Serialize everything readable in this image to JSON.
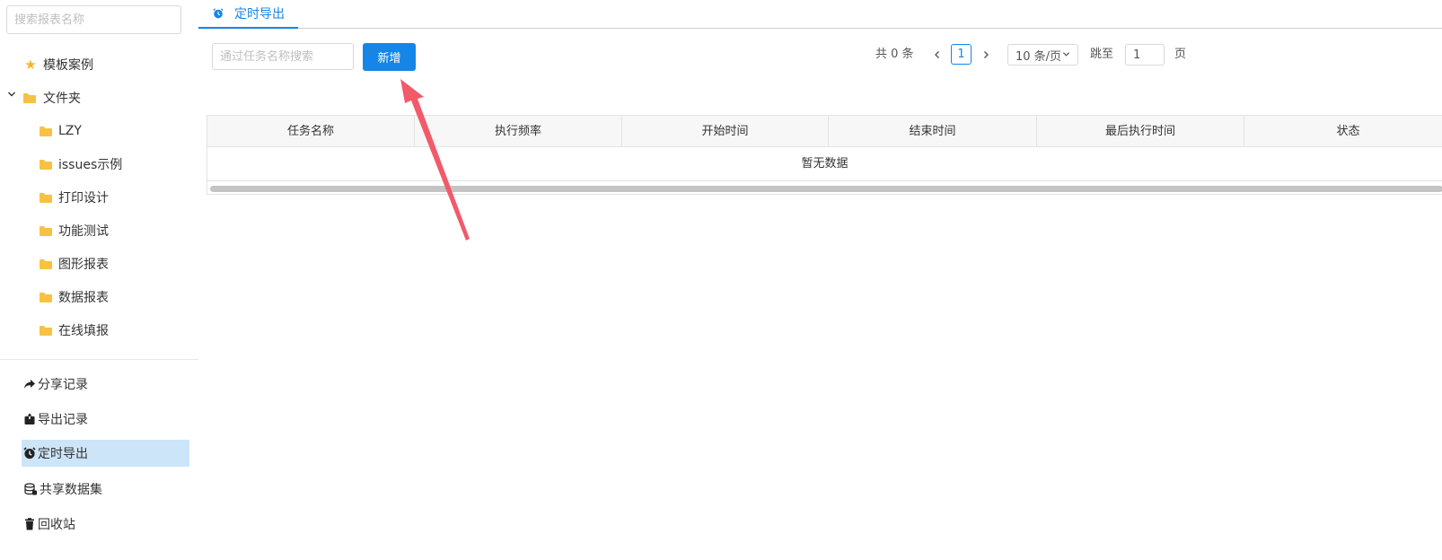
{
  "sidebar": {
    "search_placeholder": "搜索报表名称",
    "tree": [
      {
        "label": "模板案例",
        "icon": "star-icon"
      },
      {
        "label": "文件夹",
        "icon": "folder-icon"
      },
      {
        "label": "LZY",
        "icon": "folder-icon"
      },
      {
        "label": "issues示例",
        "icon": "folder-icon"
      },
      {
        "label": "打印设计",
        "icon": "folder-icon"
      },
      {
        "label": "功能测试",
        "icon": "folder-icon"
      },
      {
        "label": "图形报表",
        "icon": "folder-icon"
      },
      {
        "label": "数据报表",
        "icon": "folder-icon"
      },
      {
        "label": "在线填报",
        "icon": "folder-icon"
      }
    ],
    "bottom": [
      {
        "label": "分享记录",
        "icon": "share-icon"
      },
      {
        "label": "导出记录",
        "icon": "export-icon"
      },
      {
        "label": "定时导出",
        "icon": "alarm-clock-icon",
        "active": true
      },
      {
        "label": "共享数据集",
        "icon": "database-icon"
      },
      {
        "label": "回收站",
        "icon": "trash-icon"
      }
    ],
    "active_color": "#cde5f8",
    "folder_color": "#f7c242"
  },
  "tabs": [
    {
      "label": "定时导出",
      "icon": "alarm-clock-icon",
      "active": true
    }
  ],
  "toolbar": {
    "task_search_placeholder": "通过任务名称搜索",
    "add_label": "新增"
  },
  "pager": {
    "total_text": "共 0 条",
    "current_page": "1",
    "page_size": "10 条/页",
    "jump_label": "跳至",
    "jump_value": "1",
    "page_suffix": "页"
  },
  "table": {
    "columns": [
      "任务名称",
      "执行频率",
      "开始时间",
      "结束时间",
      "最后执行时间",
      "状态"
    ],
    "empty_text": "暂无数据"
  },
  "colors": {
    "accent": "#1486e8",
    "arrow": "#f25a6a"
  }
}
